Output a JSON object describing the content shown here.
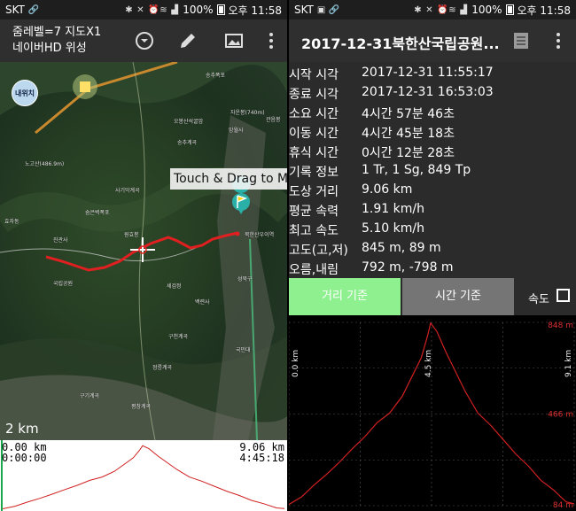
{
  "status_left": {
    "carrier": "SKT",
    "battery": "100%",
    "time": "오후 11:58"
  },
  "status_right": {
    "carrier": "SKT",
    "battery": "100%",
    "time": "오후 11:58"
  },
  "map_screen": {
    "title_line1": "줌레벨=7 지도X1",
    "title_line2": "네이버HD 위성",
    "toolbar_icons": [
      "dropdown-circle-icon",
      "pencil-icon",
      "map-image-icon",
      "more-vert-icon"
    ],
    "locate_label": "내위치",
    "tooltip": "Touch & Drag to M",
    "scale_label": "2 km",
    "start_marker_label": "북한산우이역",
    "labels": [
      "송추폭포",
      "오봉산석굴암",
      "자운봉(740m)",
      "망월사",
      "송추계곡",
      "관음봉",
      "노고산(486.9m)",
      "사기막계곡",
      "숨은벽폭포",
      "효자동",
      "원효봉",
      "진관사",
      "국립공원",
      "세검정",
      "백련사",
      "성북구",
      "구천계곡",
      "정릉계곡",
      "국민대",
      "평창계곡",
      "구기계곡"
    ],
    "mini_profile": {
      "start_distance": "0.00 km",
      "start_time": "0:00:00",
      "end_distance": "9.06 km",
      "end_time": "4:45:18"
    }
  },
  "detail_screen": {
    "title": "2017-12-31북한산국립공원...",
    "toolbar_icons": [
      "notes-icon",
      "more-vert-icon"
    ],
    "info": [
      {
        "label": "시작 시각",
        "value": "2017-12-31 11:55:17"
      },
      {
        "label": "종료 시각",
        "value": "2017-12-31 16:53:03"
      },
      {
        "label": "소요 시간",
        "value": "4시간 57분 46초"
      },
      {
        "label": "이동 시간",
        "value": "4시간 45분 18초"
      },
      {
        "label": "휴식 시간",
        "value": "0시간 12분 28초"
      },
      {
        "label": "기록 정보",
        "value": "1 Tr, 1 Sg, 849 Tp"
      },
      {
        "label": "도상 거리",
        "value": "9.06 km"
      },
      {
        "label": "평균 속력",
        "value": "1.91 km/h"
      },
      {
        "label": "최고 속도",
        "value": "5.10 km/h"
      },
      {
        "label": "고도(고,저)",
        "value": "845 m, 89 m"
      },
      {
        "label": "오름,내림",
        "value": "792 m, -798 m"
      }
    ],
    "buttons": {
      "distance": "거리 기준",
      "time": "시간 기준",
      "speed": "속도"
    },
    "colors": {
      "active_button": "#8ef08f",
      "inactive_button": "#757575",
      "profile_line": "#d02020"
    }
  },
  "chart_data": {
    "type": "line",
    "x_ticks": [
      "0.0 km",
      "4.5 km",
      "9.1 km"
    ],
    "y_ticks": [
      "848 m",
      "466 m",
      "84 m"
    ],
    "xlim": [
      0,
      9.06
    ],
    "ylim": [
      84,
      848
    ],
    "grid": true,
    "series": [
      {
        "x": [
          0,
          0.4,
          0.8,
          1.2,
          1.6,
          2.0,
          2.4,
          2.8,
          3.2,
          3.6,
          3.9,
          4.2,
          4.4,
          4.5,
          4.7,
          5.0,
          5.3,
          5.6,
          6.0,
          6.4,
          6.8,
          7.2,
          7.6,
          8.0,
          8.4,
          8.8,
          9.06
        ],
        "y": [
          89,
          120,
          170,
          215,
          265,
          320,
          370,
          430,
          470,
          540,
          620,
          700,
          790,
          845,
          810,
          720,
          640,
          560,
          470,
          420,
          360,
          300,
          250,
          190,
          150,
          100,
          92
        ]
      }
    ]
  }
}
